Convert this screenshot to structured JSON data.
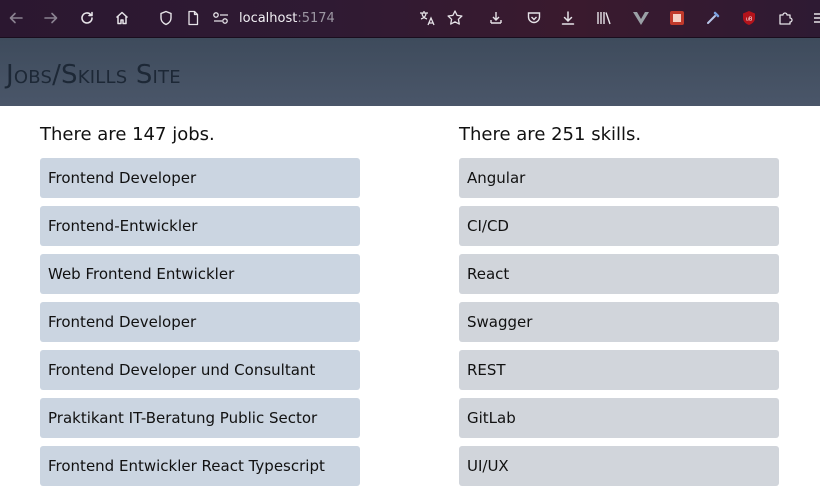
{
  "browser": {
    "url_host": "localhost",
    "url_port": ":5174"
  },
  "app": {
    "title": "Jobs/Skills Site"
  },
  "jobs": {
    "heading": "There are 147 jobs.",
    "items": [
      "Frontend Developer",
      "Frontend-Entwickler",
      "Web Frontend Entwickler",
      "Frontend Developer",
      "Frontend Developer und Consultant",
      "Praktikant IT-Beratung Public Sector",
      "Frontend Entwickler React Typescript"
    ]
  },
  "skills": {
    "heading": "There are 251 skills.",
    "items": [
      "Angular",
      "CI/CD",
      "React",
      "Swagger",
      "REST",
      "GitLab",
      "UI/UX"
    ]
  },
  "colors": {
    "header_bg": "#46515f",
    "job_card_bg": "#cbd5e1",
    "skill_card_bg": "#d1d5db"
  }
}
